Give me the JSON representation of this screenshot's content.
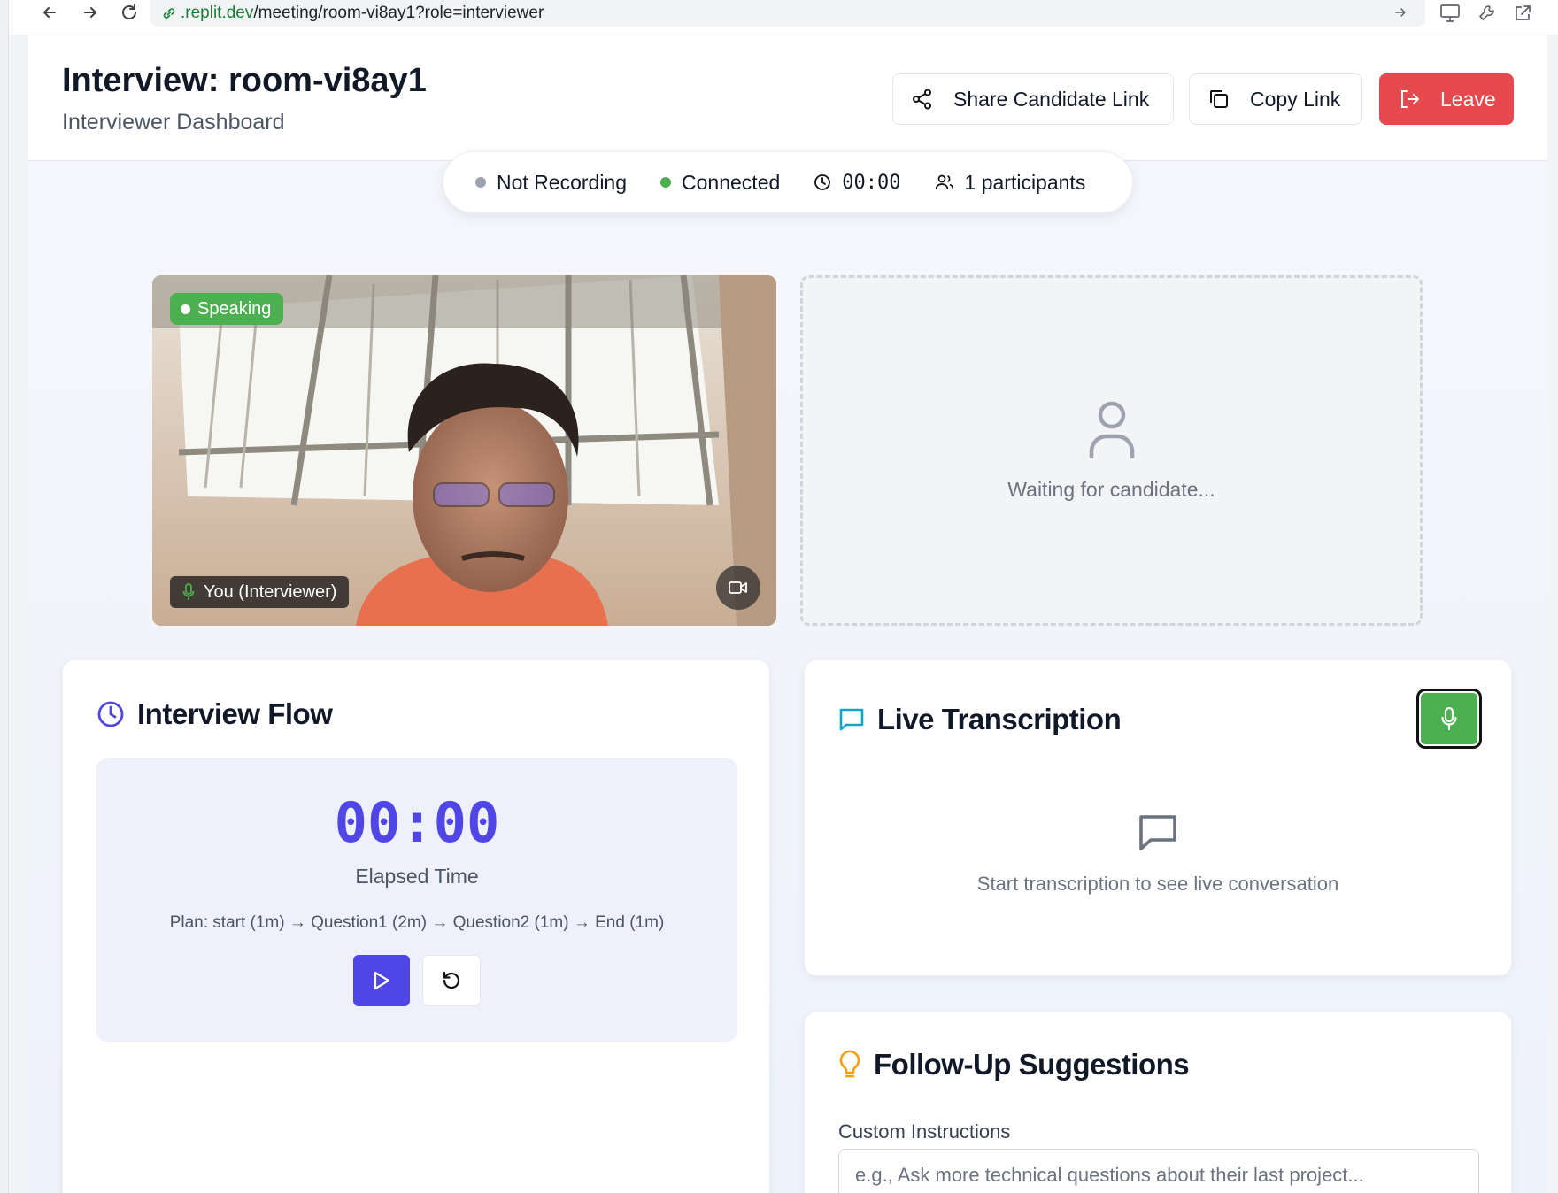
{
  "browser": {
    "url_domain": ".replit.dev",
    "url_path": "/meeting/room-vi8ay1?role=interviewer"
  },
  "header": {
    "title": "Interview: room-vi8ay1",
    "subtitle": "Interviewer Dashboard",
    "share_label": "Share Candidate Link",
    "copy_label": "Copy Link",
    "leave_label": "Leave"
  },
  "status": {
    "recording": "Not Recording",
    "connection": "Connected",
    "time": "00:00",
    "participants": "1 participants"
  },
  "video": {
    "speaking_badge": "Speaking",
    "self_label": "You (Interviewer)"
  },
  "candidate": {
    "waiting_text": "Waiting for candidate..."
  },
  "flow": {
    "title": "Interview Flow",
    "timer": "00:00",
    "elapsed_label": "Elapsed Time",
    "plan": "Plan: start (1m) → Question1 (2m) → Question2 (1m) → End (1m)"
  },
  "transcription": {
    "title": "Live Transcription",
    "empty_text": "Start transcription to see live conversation"
  },
  "followup": {
    "title": "Follow-Up Suggestions",
    "label": "Custom Instructions",
    "placeholder": "e.g., Ask more technical questions about their last project..."
  },
  "colors": {
    "accent": "#4f46e5",
    "danger": "#e5484d",
    "success": "#4caf50"
  }
}
